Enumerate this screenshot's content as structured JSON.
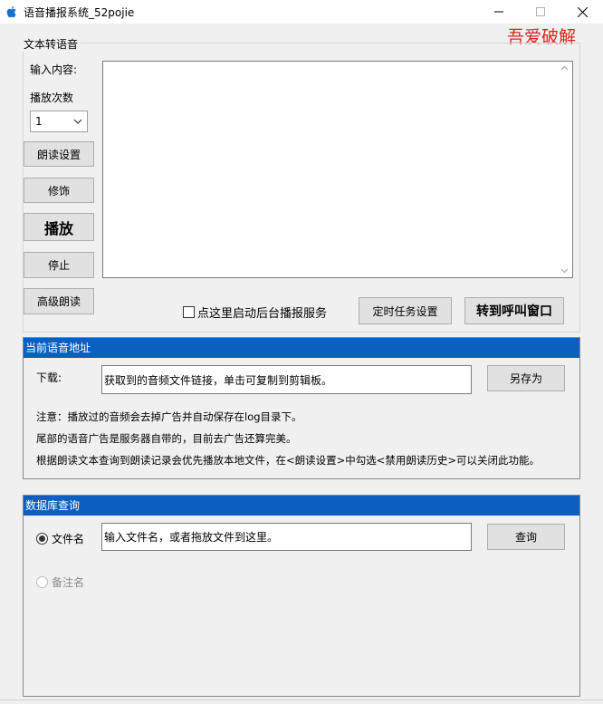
{
  "window": {
    "title": "语音播报系统_52pojie",
    "brand_text": "吾爱破解",
    "icons": {
      "app": "apple-icon",
      "minimize": "minimize-icon",
      "maximize": "maximize-icon",
      "close": "close-icon"
    }
  },
  "tts": {
    "group_label": "文本转语音",
    "input_label": "输入内容:",
    "play_count_label": "播放次数",
    "play_count_value": "1",
    "buttons": {
      "read_settings": "朗读设置",
      "modify": "修饰",
      "play": "播放",
      "stop": "停止",
      "advanced_read": "高级朗读",
      "scheduled_task": "定时任务设置",
      "to_call_window": "转到呼叫窗口"
    },
    "text_value": "",
    "background_service_label": "点这里启动后台播报服务",
    "background_service_checked": false
  },
  "current_audio": {
    "header": "当前语音地址",
    "download_label": "下载:",
    "link_text": "获取到的音频文件链接，单击可复制到剪辑板。",
    "save_as": "另存为",
    "notes": [
      "注意：播放过的音频会去掉广告并自动保存在log目录下。",
      "尾部的语音广告是服务器自带的，目前去广告还算完美。",
      "根据朗读文本查询到朗读记录会优先播放本地文件，在<朗读设置>中勾选<禁用朗读历史>可以关闭此功能。"
    ]
  },
  "db_query": {
    "header": "数据库查询",
    "radio_filename": "文件名",
    "radio_remark": "备注名",
    "filename_selected": true,
    "input_text": "输入文件名，或者拖放文件到这里。",
    "query_button": "查询"
  },
  "colors": {
    "panel_header": "#0a5fc0",
    "brand": "#e02020"
  }
}
